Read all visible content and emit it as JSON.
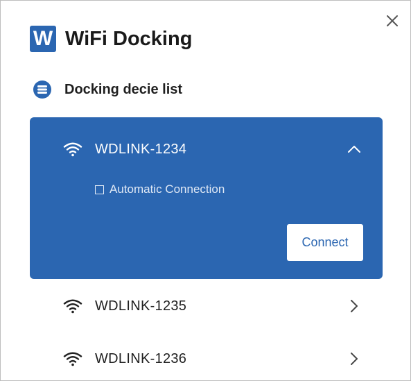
{
  "app": {
    "logo_letter": "W",
    "title": "WiFi Docking"
  },
  "section": {
    "title": "Docking decie list"
  },
  "devices": [
    {
      "name": "WDLINK-1234",
      "expanded": true,
      "auto_connection_label": "Automatic Connection",
      "auto_connection_checked": false,
      "connect_label": "Connect"
    },
    {
      "name": "WDLINK-1235",
      "expanded": false
    },
    {
      "name": "WDLINK-1236",
      "expanded": false
    }
  ],
  "colors": {
    "accent": "#2b66b1",
    "text": "#1f1f1f",
    "background": "#ffffff"
  },
  "icons": {
    "close": "close-icon",
    "list": "list-icon",
    "wifi": "wifi-icon",
    "expand_up": "chevron-up-icon",
    "expand_right": "chevron-right-icon"
  }
}
